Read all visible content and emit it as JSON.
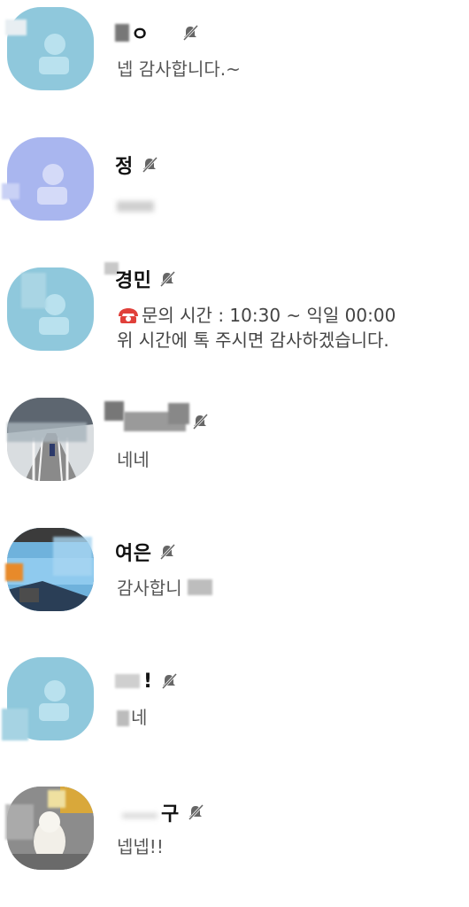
{
  "chats": [
    {
      "name": "ㅇ",
      "message": "넵 감사합니다.~",
      "muted": true,
      "avatar": "default-profile-icon",
      "avatar_color": "#8fc8dc"
    },
    {
      "name": "정",
      "message": "",
      "muted": true,
      "avatar": "default-profile-icon",
      "avatar_color": "#a9b6ef"
    },
    {
      "name": "경민",
      "message_line1": "문의 시간 : 10:30 ~ 익일 00:00",
      "message_line2": "위 시간에 톡 주시면 감사하겠습니다.",
      "message_icon": "telephone-icon",
      "muted": true,
      "avatar": "default-profile-icon",
      "avatar_color": "#8fc8dc"
    },
    {
      "name": "",
      "message": "네네",
      "muted": true,
      "avatar": "photo-avatar"
    },
    {
      "name": "여은",
      "message": "감사합니",
      "muted": true,
      "avatar": "photo-avatar"
    },
    {
      "name": "!",
      "message": "네",
      "muted": true,
      "avatar": "default-profile-icon",
      "avatar_color": "#8fc8dc"
    },
    {
      "name": "구",
      "message": "넵넵!!",
      "muted": true,
      "avatar": "photo-avatar"
    }
  ]
}
